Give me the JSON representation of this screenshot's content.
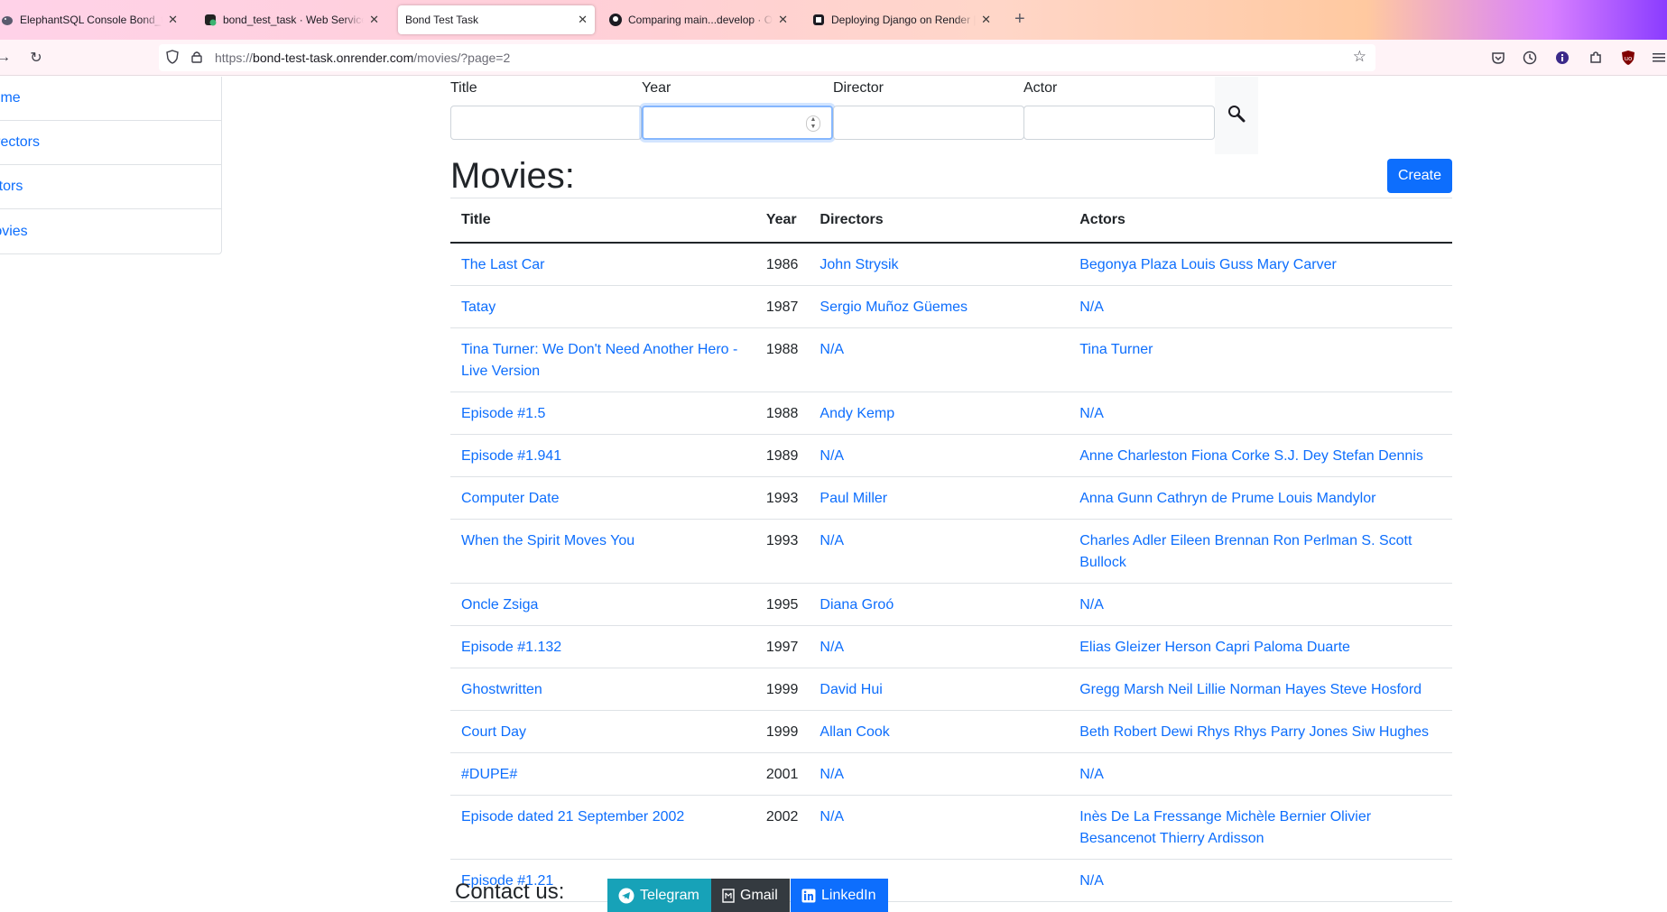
{
  "browser": {
    "tabs": [
      {
        "title": "ElephantSQL Console Bond_test",
        "icon": "elephant-icon",
        "active": false
      },
      {
        "title": "bond_test_task · Web Service",
        "icon": "render-icon",
        "active": false
      },
      {
        "title": "Bond Test Task",
        "icon": "",
        "active": true
      },
      {
        "title": "Comparing main...develop · Oc",
        "icon": "github-icon",
        "active": false
      },
      {
        "title": "Deploying Django on Render | R",
        "icon": "render-icon",
        "active": false
      }
    ],
    "url_prefix": "https://",
    "url_host": "bond-test-task.onrender.com",
    "url_path": "/movies/?page=2"
  },
  "sidebar": {
    "items": [
      "Home",
      "Directors",
      "Actors",
      "Movies"
    ]
  },
  "filters": {
    "title_label": "Title",
    "year_label": "Year",
    "director_label": "Director",
    "actor_label": "Actor"
  },
  "main": {
    "heading": "Movies:",
    "create_label": "Create",
    "columns": [
      "Title",
      "Year",
      "Directors",
      "Actors"
    ],
    "rows": [
      {
        "title": "The Last Car",
        "year": "1986",
        "directors": "John Strysik",
        "actors": "Begonya Plaza Louis Guss Mary Carver"
      },
      {
        "title": "Tatay",
        "year": "1987",
        "directors": "Sergio Muñoz Güemes",
        "actors": "N/A"
      },
      {
        "title": "Tina Turner: We Don't Need Another Hero - Live Version",
        "year": "1988",
        "directors": "N/A",
        "actors": "Tina Turner"
      },
      {
        "title": "Episode #1.5",
        "year": "1988",
        "directors": "Andy Kemp",
        "actors": "N/A"
      },
      {
        "title": "Episode #1.941",
        "year": "1989",
        "directors": "N/A",
        "actors": "Anne Charleston Fiona Corke S.J. Dey Stefan Dennis"
      },
      {
        "title": "Computer Date",
        "year": "1993",
        "directors": "Paul Miller",
        "actors": "Anna Gunn Cathryn de Prume Louis Mandylor"
      },
      {
        "title": "When the Spirit Moves You",
        "year": "1993",
        "directors": "N/A",
        "actors": "Charles Adler Eileen Brennan Ron Perlman S. Scott Bullock"
      },
      {
        "title": "Oncle Zsiga",
        "year": "1995",
        "directors": "Diana Groó",
        "actors": "N/A"
      },
      {
        "title": "Episode #1.132",
        "year": "1997",
        "directors": "N/A",
        "actors": "Elias Gleizer Herson Capri Paloma Duarte"
      },
      {
        "title": "Ghostwritten",
        "year": "1999",
        "directors": "David Hui",
        "actors": "Gregg Marsh Neil Lillie Norman Hayes Steve Hosford"
      },
      {
        "title": "Court Day",
        "year": "1999",
        "directors": "Allan Cook",
        "actors": "Beth Robert Dewi Rhys Rhys Parry Jones Siw Hughes"
      },
      {
        "title": "#DUPE#",
        "year": "2001",
        "directors": "N/A",
        "actors": "N/A"
      },
      {
        "title": "Episode dated 21 September 2002",
        "year": "2002",
        "directors": "N/A",
        "actors": "Inès De La Fressange Michèle Bernier Olivier Besancenot Thierry Ardisson"
      },
      {
        "title": "Episode #1.21",
        "year": "",
        "directors": "",
        "actors": "N/A"
      }
    ]
  },
  "footer": {
    "contact_label": "Contact us:",
    "buttons": [
      {
        "label": "Telegram",
        "icon": "telegram-icon",
        "color": "#17a2b8"
      },
      {
        "label": "Gmail",
        "icon": "gmail-icon",
        "color": "#343a40"
      },
      {
        "label": "LinkedIn",
        "icon": "linkedin-icon",
        "color": "#0d6efd"
      }
    ]
  },
  "colors": {
    "link": "#0d6efd",
    "primary_button": "#0d6efd",
    "focus_ring": "#86b7fe"
  }
}
